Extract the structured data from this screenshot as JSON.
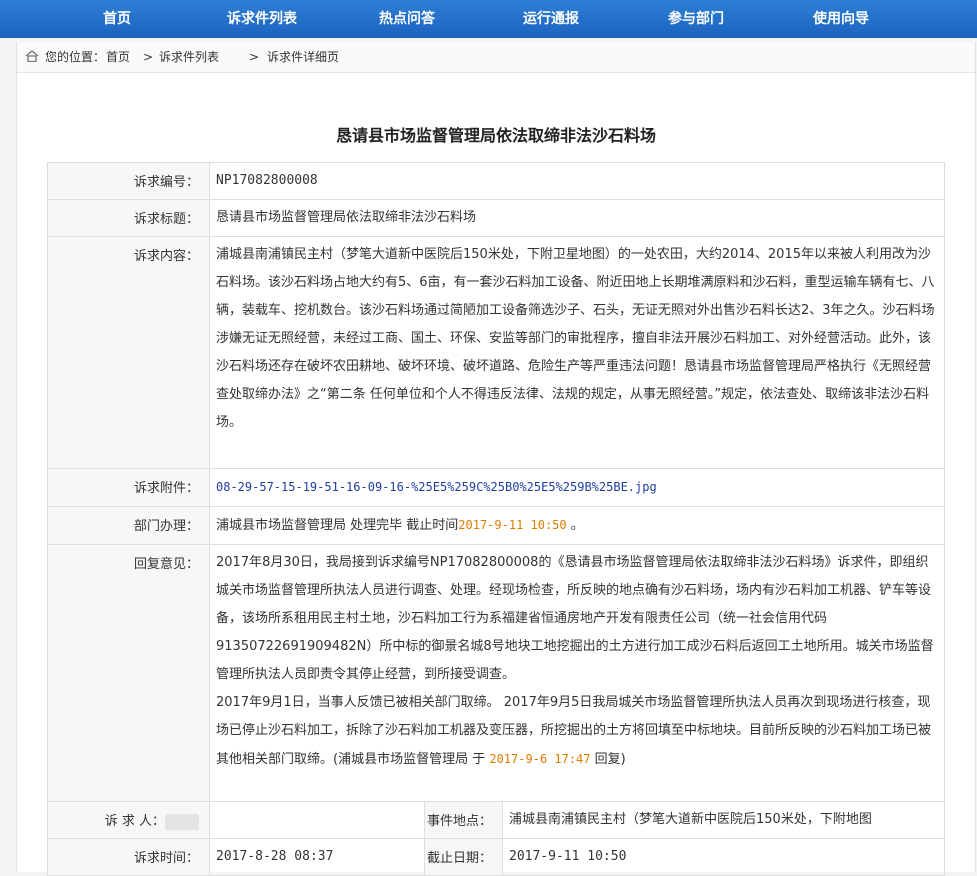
{
  "nav": {
    "items": [
      "首页",
      "诉求件列表",
      "热点问答",
      "运行通报",
      "参与部门",
      "使用向导"
    ]
  },
  "breadcrumb": {
    "prefix": "您的位置：",
    "home": "首页",
    "sep": ">",
    "list": "诉求件列表",
    "current": "诉求件详细页"
  },
  "page_title": "恳请县市场监督管理局依法取缔非法沙石料场",
  "detail": {
    "id_label": "诉求编号：",
    "id_value": "NP17082800008",
    "title_label": "诉求标题：",
    "title_value": "恳请县市场监督管理局依法取缔非法沙石料场",
    "content_label": "诉求内容：",
    "content_value": "浦城县南浦镇民主村（梦笔大道新中医院后150米处，下附卫星地图）的一处农田，大约2014、2015年以来被人利用改为沙石料场。该沙石料场占地大约有5、6亩，有一套沙石料加工设备、附近田地上长期堆满原料和沙石料，重型运输车辆有七、八辆，装载车、挖机数台。该沙石料场通过简陋加工设备筛选沙子、石头，无证无照对外出售沙石料长达2、3年之久。沙石料场涉嫌无证无照经营，未经过工商、国土、环保、安监等部门的审批程序，擅自非法开展沙石料加工、对外经营活动。此外，该沙石料场还存在破坏农田耕地、破坏环境、破坏道路、危险生产等严重违法问题！恳请县市场监督管理局严格执行《无照经营查处取缔办法》之“第二条 任何单位和个人不得违反法律、法规的规定，从事无照经营。”规定，依法查处、取缔该非法沙石料场。",
    "attach_label": "诉求附件：",
    "attach_value": "08-29-57-15-19-51-16-09-16-%25E5%259C%25B0%25E5%259B%25BE.jpg",
    "dept_label": "部门办理：",
    "dept_value": "浦城县市场监督管理局 处理完毕 截止时间",
    "dept_deadline": "2017-9-11 10:50",
    "dept_end": " 。",
    "reply_label": "回复意见：",
    "reply_p1": "2017年8月30日，我局接到诉求编号NP17082800008的《恳请县市场监督管理局依法取缔非法沙石料场》诉求件，即组织城关市场监督管理所执法人员进行调查、处理。经现场检查，所反映的地点确有沙石料场，场内有沙石料加工机器、铲车等设备，该场所系租用民主村土地，沙石料加工行为系福建省恒通房地产开发有限责任公司（统一社会信用代码91350722691909482N）所中标的御景名城8号地块工地挖掘出的土方进行加工成沙石料后返回工土地所用。城关市场监督管理所执法人员即责令其停止经营，到所接受调查。",
    "reply_p2": "2017年9月1日，当事人反馈已被相关部门取缔。 2017年9月5日我局城关市场监督管理所执法人员再次到现场进行核查，现场已停止沙石料加工，拆除了沙石料加工机器及变压器，所挖掘出的土方将回填至中标地块。目前所反映的沙石料加工场已被其他相关部门取缔。(浦城县市场监督管理局 于 ",
    "reply_date": "2017-9-6 17:47",
    "reply_end": " 回复)",
    "person_label": "诉 求 人：",
    "location_label": "事件地点：",
    "location_value": "浦城县南浦镇民主村（梦笔大道新中医院后150米处，下附地图",
    "time_label": "诉求时间：",
    "time_value": "2017-8-28 08:37",
    "deadline_label": "截止日期：",
    "deadline_value": "2017-9-11 10:50"
  },
  "colors": {
    "nav": "#1b63be",
    "deadline": "#e07b00",
    "attachment": "#1f3f9e"
  }
}
